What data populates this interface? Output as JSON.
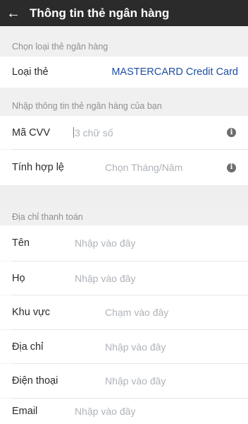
{
  "header": {
    "back_icon": "arrow-left-icon",
    "title": "Thông tin thẻ ngân hàng"
  },
  "card_type_section": {
    "header": "Chọn loại thẻ ngân hàng",
    "label": "Loại thẻ",
    "value": "MASTERCARD Credit Card"
  },
  "card_info_section": {
    "header": "Nhập thông tin thẻ ngân hàng của bạn",
    "cvv": {
      "label": "Mã CVV",
      "placeholder": "3 chữ số",
      "icon": "info-icon"
    },
    "expiry": {
      "label": "Tính hợp lệ",
      "placeholder": "Chọn Tháng/Năm",
      "icon": "info-icon"
    }
  },
  "billing_section": {
    "header": "Địa chỉ thanh toán",
    "fields": [
      {
        "label": "Tên",
        "placeholder": "Nhập vào đây"
      },
      {
        "label": "Họ",
        "placeholder": "Nhập vào đây"
      },
      {
        "label": "Khu vực",
        "placeholder": "Chạm vào đây"
      },
      {
        "label": "Địa chỉ",
        "placeholder": "Nhập vào đây"
      },
      {
        "label": "Điện thoại",
        "placeholder": "Nhập vào đây"
      },
      {
        "label": "Email",
        "placeholder": "Nhập vào đây"
      }
    ]
  },
  "colors": {
    "appbar": "#2b2b2b",
    "link": "#1f4fa3",
    "placeholder": "#aeb3b8",
    "section_bg": "#f0f0f0"
  }
}
